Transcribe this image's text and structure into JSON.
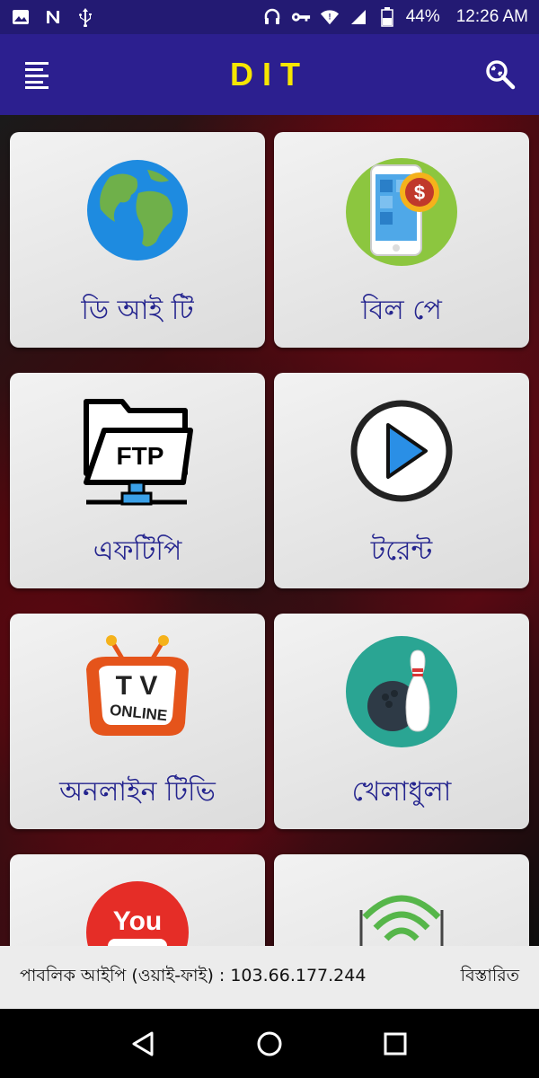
{
  "status_bar": {
    "battery": "44%",
    "time": "12:26 AM",
    "icons_left": [
      "image-icon",
      "n-icon",
      "usb-icon"
    ],
    "icons_right": [
      "headset-icon",
      "vpn-key-icon",
      "wifi-icon",
      "signal-icon",
      "battery-icon"
    ]
  },
  "app_bar": {
    "title": "DIT",
    "menu_icon": "menu-icon",
    "search_icon": "search-icon"
  },
  "tiles": [
    {
      "label": "ডি আই টি",
      "icon": "globe-icon"
    },
    {
      "label": "বিল পে",
      "icon": "mobile-payment-icon"
    },
    {
      "label": "এফটিপি",
      "icon": "ftp-folder-icon"
    },
    {
      "label": "টরেন্ট",
      "icon": "play-icon"
    },
    {
      "label": "অনলাইন টিভি",
      "icon": "tv-online-icon"
    },
    {
      "label": "খেলাধুলা",
      "icon": "bowling-icon"
    },
    {
      "label": "",
      "icon": "youtube-icon"
    },
    {
      "label": "",
      "icon": "router-icon"
    }
  ],
  "tv_icon_text": {
    "tv": "T V",
    "online": "ONLINE"
  },
  "youtube_icon_text": "You",
  "ftp_icon_text": "FTP",
  "info_bar": {
    "public_ip_text": "পাবলিক আইপি (ওয়াই-ফাই) : 103.66.177.244",
    "details_link": "বিস্তারিত"
  },
  "nav_bar": {
    "back_icon": "back-icon",
    "home_icon": "home-icon",
    "recents_icon": "recents-icon"
  }
}
